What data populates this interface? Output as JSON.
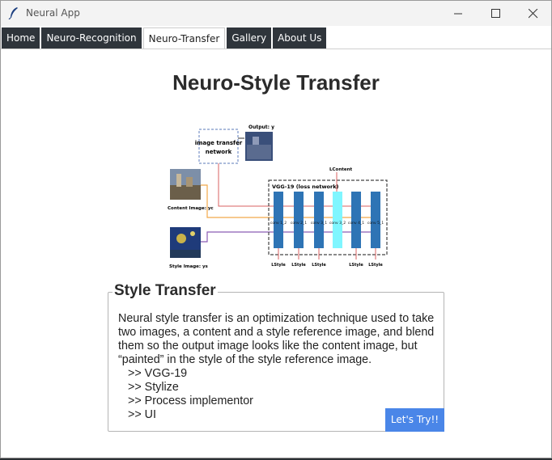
{
  "window": {
    "title": "Neural App"
  },
  "tabs": [
    {
      "label": "Home"
    },
    {
      "label": "Neuro-Recognition"
    },
    {
      "label": "Neuro-Transfer"
    },
    {
      "label": "Gallery"
    },
    {
      "label": "About Us"
    }
  ],
  "active_tab": "Neuro-Transfer",
  "page": {
    "title": "Neuro-Style Transfer"
  },
  "diagram": {
    "output_label": "Output: y",
    "transfer_net_label_1": "image transfer",
    "transfer_net_label_2": "network",
    "content_label": "Content Image: yc",
    "style_label": "Style Image: ys",
    "loss_content": "LContent",
    "vgg_label": "VGG-19 (loss network)",
    "convs": [
      "conv 1_2",
      "conv 2_1",
      "conv 3_1",
      "conv 3_2",
      "conv 4_1",
      "conv 5_1"
    ],
    "l_style": "LStyle"
  },
  "section": {
    "title": "Style Transfer",
    "description": "Neural style transfer is an optimization technique used to take two images, a content and a style reference image, and blend them so the output image looks like the content image, but “painted” in the style of the style reference image.",
    "bullets": [
      ">> VGG-19",
      ">> Stylize",
      ">> Process implementor",
      ">> UI"
    ],
    "button_label": "Let's Try!!"
  },
  "colors": {
    "tab_bg": "#2f353b",
    "button_bg": "#4a86e8",
    "highlight_conv": "#7ff6ff",
    "conv": "#2e74b5"
  }
}
